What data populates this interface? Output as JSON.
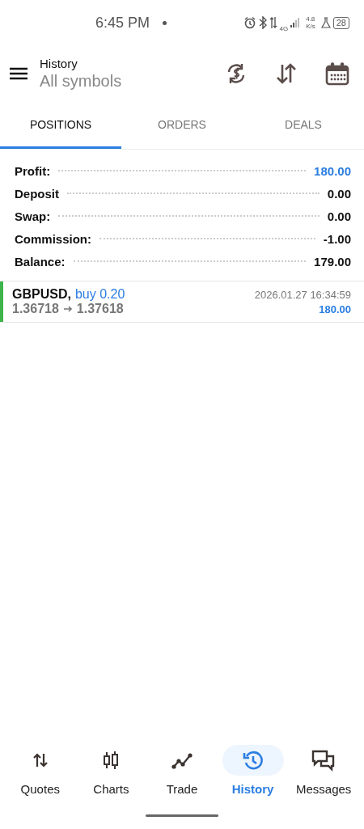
{
  "status_bar": {
    "time": "6:45 PM",
    "network": "4G",
    "speed_value": "4.8",
    "speed_unit": "K/s",
    "battery": "28"
  },
  "header": {
    "title": "History",
    "subtitle": "All symbols"
  },
  "tabs": [
    {
      "label": "POSITIONS",
      "selected": true
    },
    {
      "label": "ORDERS",
      "selected": false
    },
    {
      "label": "DEALS",
      "selected": false
    }
  ],
  "summary": [
    {
      "label": "Profit:",
      "value": "180.00",
      "accent": true
    },
    {
      "label": "Deposit",
      "value": "0.00",
      "accent": false
    },
    {
      "label": "Swap:",
      "value": "0.00",
      "accent": false
    },
    {
      "label": "Commission:",
      "value": "-1.00",
      "accent": false
    },
    {
      "label": "Balance:",
      "value": "179.00",
      "accent": false
    }
  ],
  "positions": [
    {
      "symbol": "GBPUSD,",
      "side": "buy 0.20",
      "open_price": "1.36718",
      "close_price": "1.37618",
      "time": "2026.01.27 16:34:59",
      "profit": "180.00",
      "color": "#3db54a"
    }
  ],
  "bottom_nav": [
    {
      "label": "Quotes",
      "kind": "quotes",
      "selected": false
    },
    {
      "label": "Charts",
      "kind": "charts",
      "selected": false
    },
    {
      "label": "Trade",
      "kind": "trade",
      "selected": false
    },
    {
      "label": "History",
      "kind": "history",
      "selected": true
    },
    {
      "label": "Messages",
      "kind": "messages",
      "selected": false
    }
  ]
}
